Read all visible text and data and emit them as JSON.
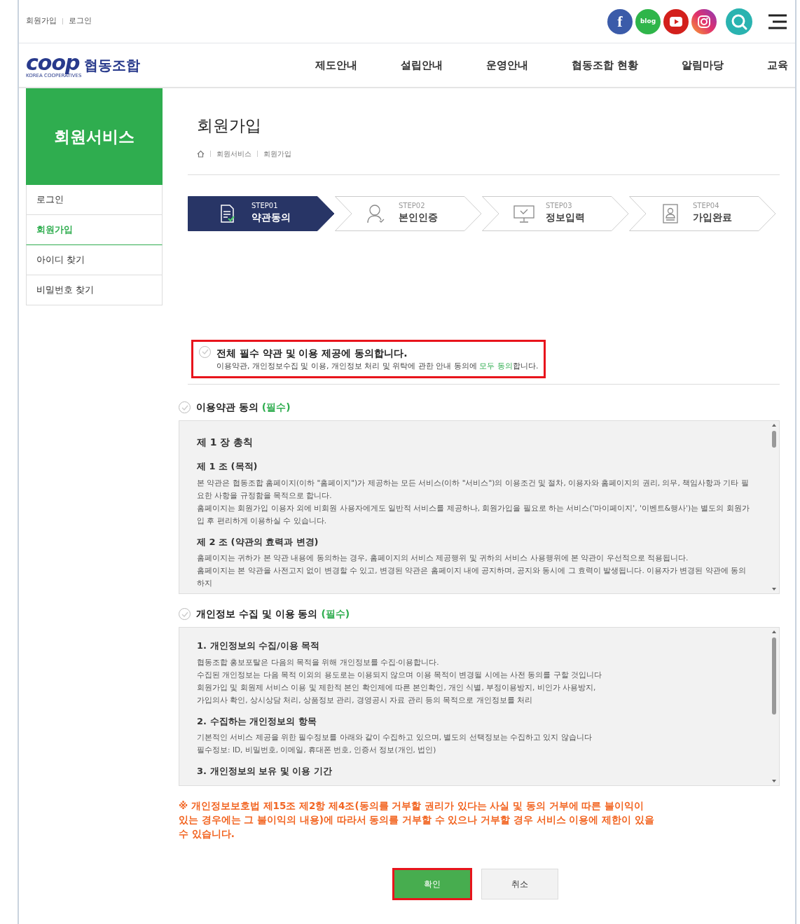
{
  "top_links": [
    {
      "label": "회원가입"
    },
    {
      "label": "로그인"
    }
  ],
  "social": [
    {
      "kind": "facebook",
      "label": "f"
    },
    {
      "kind": "blog",
      "label": "blog"
    },
    {
      "kind": "youtube"
    },
    {
      "kind": "instagram"
    },
    {
      "kind": "search"
    },
    {
      "kind": "menu"
    }
  ],
  "logo": {
    "mark": "coop",
    "subtitle": "KOREA COOPERATIVES",
    "name": "협동조합"
  },
  "nav": [
    "제도안내",
    "설립안내",
    "운영안내",
    "협동조합 현황",
    "알림마당",
    "교육"
  ],
  "sidebar": {
    "title": "회원서비스",
    "items": [
      {
        "label": "로그인",
        "selected": false
      },
      {
        "label": "회원가입",
        "selected": true
      },
      {
        "label": "아이디 찾기",
        "selected": false
      },
      {
        "label": "비밀번호 찾기",
        "selected": false
      }
    ]
  },
  "page": {
    "title": "회원가입",
    "breadcrumb": [
      "회원서비스",
      "회원가입"
    ]
  },
  "steps": [
    {
      "number": "STEP01",
      "label": "약관동의",
      "active": true
    },
    {
      "number": "STEP02",
      "label": "본인인증",
      "active": false
    },
    {
      "number": "STEP03",
      "label": "정보입력",
      "active": false
    },
    {
      "number": "STEP04",
      "label": "가입완료",
      "active": false
    }
  ],
  "agree_all": {
    "checked": false,
    "highlighted": true,
    "title": "전체 필수 약관 및 이용 제공에 동의합니다.",
    "description_before": "이용약관, 개인정보수집 및 이용, 개인정보 처리 및 위탁에 관한 안내 동의에 ",
    "description_link": "모두 동의",
    "description_after": "합니다."
  },
  "sections": [
    {
      "title": "이용약관 동의",
      "required": "(필수)",
      "checked": false,
      "content": [
        {
          "kind": "chapter",
          "text": "제 1 장 총칙"
        },
        {
          "kind": "heading",
          "text": "제 1 조 (목적)"
        },
        {
          "kind": "para",
          "text": "본 약관은 협동조합 홈페이지(이하 \"홈페이지\")가 제공하는 모든 서비스(이하 \"서비스\")의 이용조건 및 절차, 이용자와 홈페이지의 권리, 의무, 책임사항과 기타 필요한 사항을 규정함을 목적으로 합니다."
        },
        {
          "kind": "para",
          "text": "홈페이지는 회원가입 이용자 외에 비회원 사용자에게도 일반적 서비스를 제공하나, 회원가입을 필요로 하는 서비스('마이페이지', '이벤트&행사')는 별도의 회원가입 후 편리하게 이용하실 수 있습니다."
        },
        {
          "kind": "heading",
          "text": "제 2 조 (약관의 효력과 변경)"
        },
        {
          "kind": "para",
          "text": "홈페이지는 귀하가 본 약관 내용에 동의하는 경우, 홈페이지의 서비스 제공행위 및 귀하의 서비스 사용행위에 본 약관이 우선적으로 적용됩니다."
        },
        {
          "kind": "para",
          "text": "홈페이지는 본 약관을 사전고지 없이 변경할 수 있고, 변경된 약관은 홈페이지 내에 공지하며, 공지와 동시에 그 효력이 발생됩니다. 이용자가 변경된 약관에 동의하지"
        }
      ]
    },
    {
      "title": "개인정보 수집 및 이용 동의",
      "required": "(필수)",
      "checked": false,
      "content": [
        {
          "kind": "heading",
          "text": "1. 개인정보의 수집/이용 목적"
        },
        {
          "kind": "para",
          "text": "협동조합 홍보포탈은 다음의 목적을 위해 개인정보를 수집·이용합니다."
        },
        {
          "kind": "para",
          "text": "수집된 개인정보는 다음 목적 이외의 용도로는 이용되지 않으며 이용 목적이 변경될 시에는 사전 동의를 구할 것입니다"
        },
        {
          "kind": "para",
          "text": "회원가입 및 회원제 서비스 이용 및 제한적 본인 확인제에 따른 본인확인, 개인 식별, 부정이용방지, 비인가 사용방지,"
        },
        {
          "kind": "para",
          "text": "가입의사 확인, 상시상담 처리, 상품정보 관리, 경영공시 자료 관리 등의 목적으로 개인정보를 처리"
        },
        {
          "kind": "heading",
          "text": "2. 수집하는 개인정보의 항목"
        },
        {
          "kind": "para",
          "text": "기본적인 서비스 제공을 위한 필수정보를 아래와 같이 수집하고 있으며, 별도의 선택정보는 수집하고 있지 않습니다"
        },
        {
          "kind": "para",
          "text": "필수정보: ID, 비밀번호, 이메일, 휴대폰 번호, 인증서 정보(개인, 법인)"
        },
        {
          "kind": "heading",
          "text": "3. 개인정보의 보유 및 이용 기간"
        }
      ]
    }
  ],
  "notice": "※ 개인정보보호법 제15조 제2항 제4조(동의를 거부할 권리가 있다는 사실 및 동의 거부에 따른 불이익이 있는 경우에는 그 불이익의 내용)에 따라서 동의를 거부할 수 있으나 거부할 경우 서비스 이용에 제한이 있을 수 있습니다.",
  "buttons": [
    {
      "label": "확인",
      "kind": "primary",
      "highlighted": true
    },
    {
      "label": "취소",
      "kind": "secondary",
      "highlighted": false
    }
  ]
}
